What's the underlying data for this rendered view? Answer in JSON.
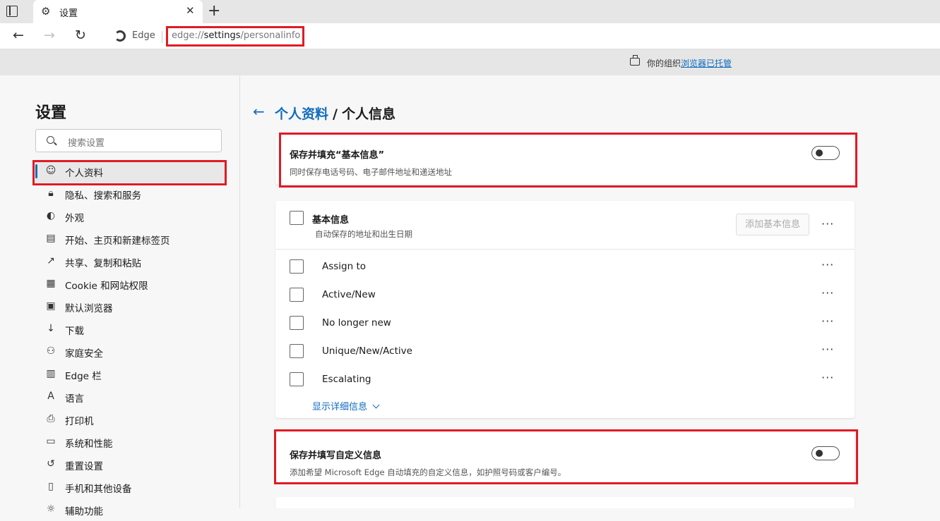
{
  "browser": {
    "tab_title": "设置",
    "edge_label": "Edge",
    "url_prefix": "edge://",
    "url_highlight": "settings",
    "url_suffix": "/personalinfo"
  },
  "managed": {
    "text": "你的组织",
    "link": "浏览器已托管"
  },
  "sidebar": {
    "title": "设置",
    "search_placeholder": "搜索设置",
    "items": [
      {
        "label": "个人资料",
        "icon": "profile-icon"
      },
      {
        "label": "隐私、搜索和服务",
        "icon": "lock-icon"
      },
      {
        "label": "外观",
        "icon": "palette-icon"
      },
      {
        "label": "开始、主页和新建标签页",
        "icon": "home-tab-icon"
      },
      {
        "label": "共享、复制和粘贴",
        "icon": "share-icon"
      },
      {
        "label": "Cookie 和网站权限",
        "icon": "site-permissions-icon"
      },
      {
        "label": "默认浏览器",
        "icon": "browser-icon"
      },
      {
        "label": "下载",
        "icon": "download-icon"
      },
      {
        "label": "家庭安全",
        "icon": "family-icon"
      },
      {
        "label": "Edge 栏",
        "icon": "edge-bar-icon"
      },
      {
        "label": "语言",
        "icon": "language-icon"
      },
      {
        "label": "打印机",
        "icon": "printer-icon"
      },
      {
        "label": "系统和性能",
        "icon": "laptop-icon"
      },
      {
        "label": "重置设置",
        "icon": "reset-icon"
      },
      {
        "label": "手机和其他设备",
        "icon": "phone-icon"
      },
      {
        "label": "辅助功能",
        "icon": "accessibility-icon"
      }
    ]
  },
  "main": {
    "breadcrumb_parent": "个人资料",
    "breadcrumb_sep": "/",
    "breadcrumb_current": "个人信息",
    "basic_toggle": {
      "title": "保存并填充“基本信息”",
      "desc": "同时保存电话号码、电子邮件地址和递送地址"
    },
    "basic_card": {
      "title": "基本信息",
      "desc": "自动保存的地址和出生日期",
      "add_button": "添加基本信息",
      "rows": [
        "Assign to",
        "Active/New",
        "No longer new",
        "Unique/New/Active",
        "Escalating"
      ],
      "show_more": "显示详细信息"
    },
    "custom_toggle": {
      "title": "保存并填写自定义信息",
      "desc": "添加希望 Microsoft Edge 自动填充的自定义信息，如护照号码或客户编号。"
    }
  }
}
